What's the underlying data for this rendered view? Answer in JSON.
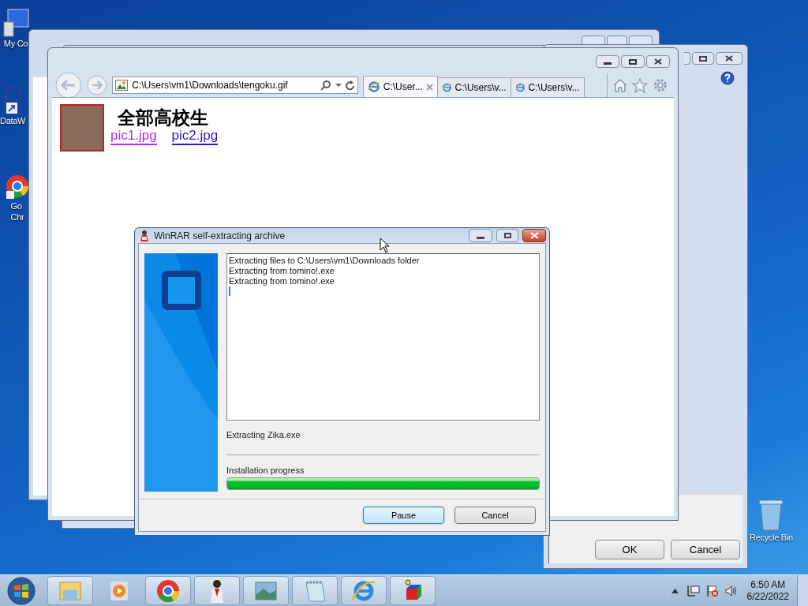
{
  "desktop_icons": [
    {
      "lines": [
        "My Co"
      ],
      "kind": "computer"
    },
    {
      "lines": [
        "DataW"
      ],
      "kind": "shortcut"
    },
    {
      "lines": [
        "Go",
        "Chr"
      ],
      "kind": "chrome"
    },
    {
      "lines": [
        "Recycle Bin"
      ],
      "kind": "bin"
    }
  ],
  "browser": {
    "address": "C:\\Users\\vm1\\Downloads\\tengoku.gif",
    "tabs": [
      {
        "label": "C:\\User...",
        "selected": true
      },
      {
        "label": "C:\\Users\\v...",
        "selected": false
      },
      {
        "label": "C:\\Users\\v...",
        "selected": false
      }
    ],
    "page": {
      "heading": "全部高校生",
      "links": [
        {
          "label": "pic1.jpg",
          "visited": true
        },
        {
          "label": "pic2.jpg",
          "visited": false
        }
      ]
    }
  },
  "back_dialog": {
    "buttons": [
      "OK",
      "Cancel"
    ]
  },
  "winrar": {
    "title": "WinRAR self-extracting archive",
    "log": [
      "Extracting files to C:\\Users\\vm1\\Downloads folder",
      "Extracting from tomino!.exe",
      "Extracting from tomino!.exe"
    ],
    "status": "Extracting Zika.exe",
    "progress_label": "Installation progress",
    "progress": {
      "level": 1.0
    },
    "buttons": [
      {
        "label": "Pause",
        "default": true
      },
      {
        "label": "Cancel",
        "default": false
      }
    ]
  },
  "taskbar": {
    "time": "6:50 AM",
    "date": "6/22/2022"
  }
}
